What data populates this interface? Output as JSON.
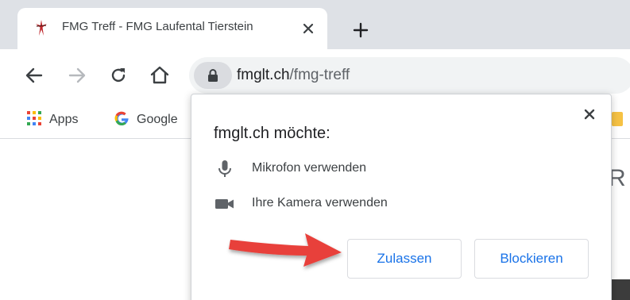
{
  "tab": {
    "title": "FMG Treff - FMG Laufental Tierstein",
    "favicon": "fmg-cross-icon",
    "close": "close-icon"
  },
  "new_tab": {
    "icon": "plus-icon"
  },
  "toolbar": {
    "back": "back-arrow-icon",
    "forward": "forward-arrow-icon",
    "reload": "reload-icon",
    "home": "home-icon",
    "lock": "lock-icon",
    "url_domain": "fmglt.ch",
    "url_path": "/fmg-treff"
  },
  "bookmarks": {
    "apps": {
      "icon": "apps-grid-icon",
      "label": "Apps"
    },
    "google": {
      "icon": "google-icon",
      "label": "Google"
    },
    "folder": "folder-icon"
  },
  "page": {
    "partial_letter": "R"
  },
  "dialog": {
    "title": "fmglt.ch möchte:",
    "close": "close-icon",
    "permissions": [
      {
        "icon": "microphone-icon",
        "label": "Mikrofon verwenden"
      },
      {
        "icon": "camera-icon",
        "label": "Ihre Kamera verwenden"
      }
    ],
    "allow_label": "Zulassen",
    "block_label": "Blockieren"
  },
  "annotation": {
    "icon": "red-arrow-icon"
  },
  "colors": {
    "tab_strip": "#dee1e6",
    "omnibox": "#f1f3f4",
    "button_text": "#1a73e8",
    "arrow": "#e8413a"
  }
}
